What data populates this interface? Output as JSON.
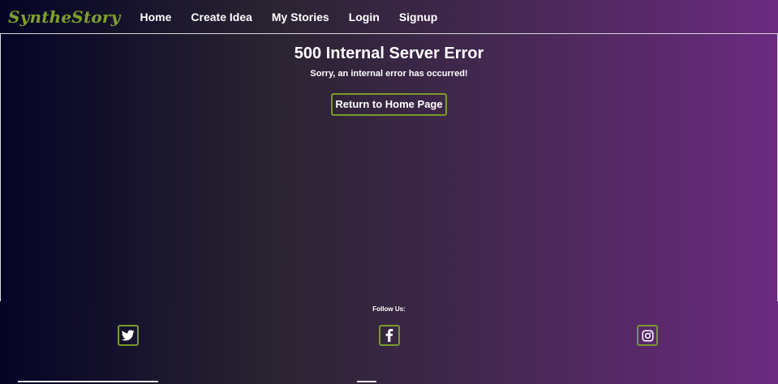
{
  "navbar": {
    "brand": "SyntheStory",
    "links": [
      "Home",
      "Create Idea",
      "My Stories",
      "Login",
      "Signup"
    ]
  },
  "main": {
    "error_title": "500 Internal Server Error",
    "error_message": "Sorry, an internal error has occurred!",
    "home_button": "Return to Home Page"
  },
  "footer": {
    "follow_label": "Follow Us:",
    "social_icons": [
      "twitter-icon",
      "facebook-icon",
      "instagram-icon"
    ]
  },
  "colors": {
    "brand": "#7ea12a",
    "accent_border": "#7a9a2a",
    "gradient_start": "#050426",
    "gradient_end": "#6b2a80",
    "text": "#ffffff"
  }
}
